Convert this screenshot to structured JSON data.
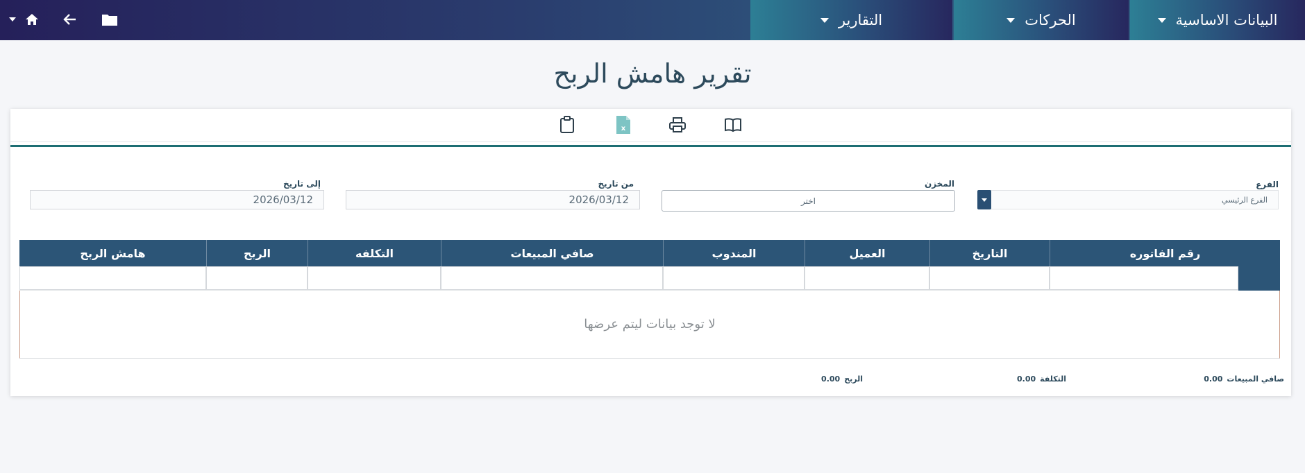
{
  "nav": {
    "basic_data": "البيانات الاساسية",
    "movements": "الحركات",
    "reports": "التقارير"
  },
  "icons": {
    "home": "home-icon",
    "back": "arrow-left-icon",
    "folder": "folder-icon",
    "book": "book-open-icon",
    "print": "printer-icon",
    "excel": "excel-file-icon",
    "clipboard": "clipboard-icon"
  },
  "page": {
    "title": "تقرير هامش الربح"
  },
  "filters": {
    "branch_label": "الفرع",
    "branch_value": "الفرع الرئيسي",
    "store_label": "المخزن",
    "store_value": "اختر",
    "from_label": "من تاريخ",
    "from_value": "2026/03/12",
    "to_label": "إلى تاريخ",
    "to_value": "2026/03/12"
  },
  "table": {
    "columns": [
      "رقم الفاتوره",
      "التاريخ",
      "العميل",
      "المندوب",
      "صافي المبيعات",
      "التكلفه",
      "الربح",
      "هامش الربح"
    ],
    "empty_message": "لا توجد بيانات ليتم عرضها"
  },
  "totals": {
    "net_sales_label": "صافي المبيعات",
    "net_sales_value": "0.00",
    "cost_label": "التكلفة",
    "cost_value": "0.00",
    "profit_label": "الربح",
    "profit_value": "0.00"
  },
  "colors": {
    "header_bg": "#2c5577",
    "accent_line": "#1d6e73",
    "topbar": "#25205a"
  }
}
